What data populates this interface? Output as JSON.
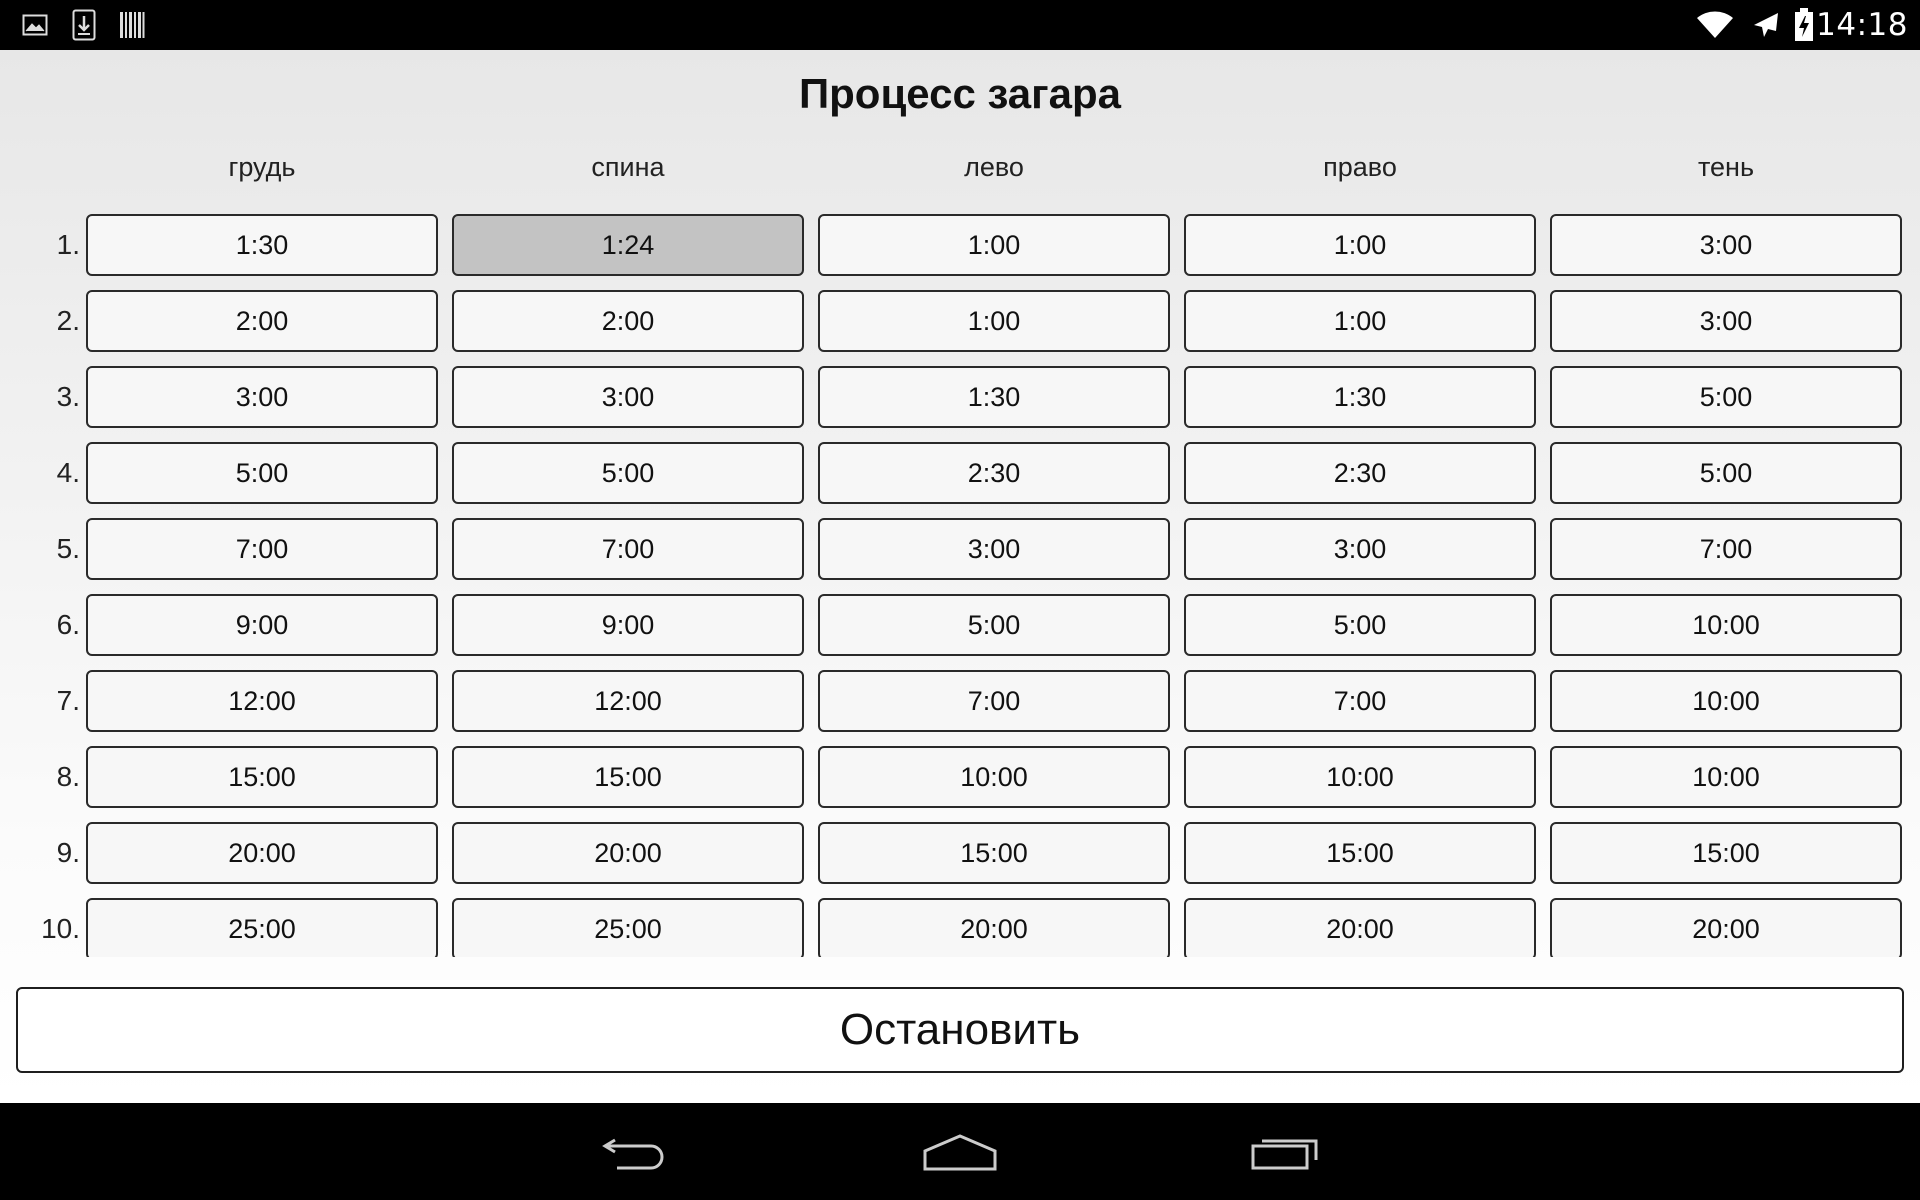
{
  "status_bar": {
    "clock": "14:18",
    "left_icons": [
      "gallery-icon",
      "download-icon",
      "barcode-icon"
    ],
    "right_icons": [
      "wifi-icon",
      "airplane-mode-icon",
      "battery-charging-icon"
    ]
  },
  "title": "Процесс загара",
  "columns": [
    "грудь",
    "спина",
    "лево",
    "право",
    "тень"
  ],
  "rows": [
    {
      "num": "1.",
      "cells": [
        "1:30",
        "1:24",
        "1:00",
        "1:00",
        "3:00"
      ]
    },
    {
      "num": "2.",
      "cells": [
        "2:00",
        "2:00",
        "1:00",
        "1:00",
        "3:00"
      ]
    },
    {
      "num": "3.",
      "cells": [
        "3:00",
        "3:00",
        "1:30",
        "1:30",
        "5:00"
      ]
    },
    {
      "num": "4.",
      "cells": [
        "5:00",
        "5:00",
        "2:30",
        "2:30",
        "5:00"
      ]
    },
    {
      "num": "5.",
      "cells": [
        "7:00",
        "7:00",
        "3:00",
        "3:00",
        "7:00"
      ]
    },
    {
      "num": "6.",
      "cells": [
        "9:00",
        "9:00",
        "5:00",
        "5:00",
        "10:00"
      ]
    },
    {
      "num": "7.",
      "cells": [
        "12:00",
        "12:00",
        "7:00",
        "7:00",
        "10:00"
      ]
    },
    {
      "num": "8.",
      "cells": [
        "15:00",
        "15:00",
        "10:00",
        "10:00",
        "10:00"
      ]
    },
    {
      "num": "9.",
      "cells": [
        "20:00",
        "20:00",
        "15:00",
        "15:00",
        "15:00"
      ]
    },
    {
      "num": "10.",
      "cells": [
        "25:00",
        "25:00",
        "20:00",
        "20:00",
        "20:00"
      ]
    }
  ],
  "active_cell": {
    "row": 0,
    "col": 1
  },
  "stop_button": "Остановить",
  "nav_bar": {
    "buttons": [
      "back-icon",
      "home-icon",
      "recent-apps-icon"
    ]
  },
  "colors": {
    "active_cell_bg": "#c3c3c3",
    "cell_border": "#2a2a2a",
    "status_bar_bg": "#000000"
  }
}
